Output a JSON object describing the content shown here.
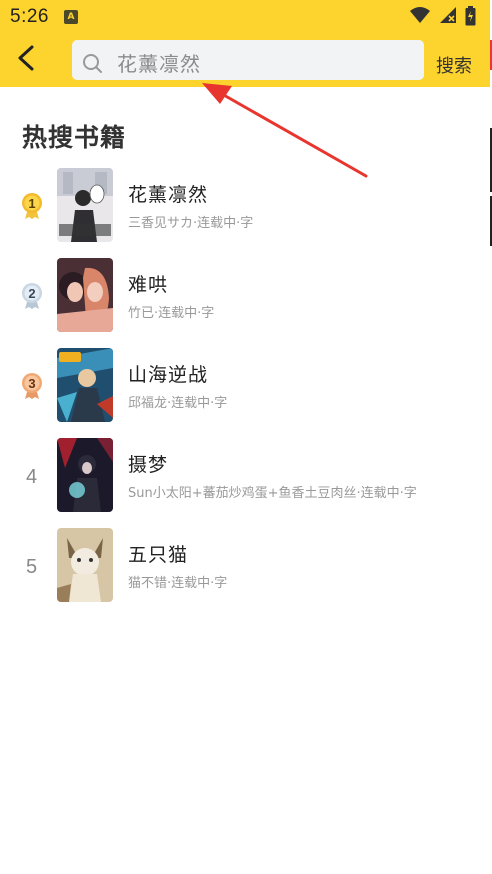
{
  "status_bar": {
    "time": "5:26",
    "app_icon": "A",
    "icons": [
      "wifi-icon",
      "signal-icon",
      "battery-icon"
    ]
  },
  "header": {
    "back_icon": "back-arrow-icon",
    "search_placeholder": "花薰凛然",
    "search_button": "搜索"
  },
  "section": {
    "title": "热搜书籍"
  },
  "books": [
    {
      "rank": "1",
      "title": "花薰凛然",
      "meta": "三香见サカ·连载中·字"
    },
    {
      "rank": "2",
      "title": "难哄",
      "meta": "竹已·连载中·字"
    },
    {
      "rank": "3",
      "title": "山海逆战",
      "meta": "邱福龙·连载中·字"
    },
    {
      "rank": "4",
      "title": "摄梦",
      "meta": "Sun小太阳+蕃茄炒鸡蛋+鱼香土豆肉丝·连载中·字"
    },
    {
      "rank": "5",
      "title": "五只猫",
      "meta": "猫不错·连载中·字"
    }
  ],
  "colors": {
    "header_bg": "#FDD32E",
    "gold_badge": "#F5B92E",
    "silver_badge": "#C9D6E3",
    "bronze_badge": "#F0A874",
    "arrow": "#E8362F"
  }
}
